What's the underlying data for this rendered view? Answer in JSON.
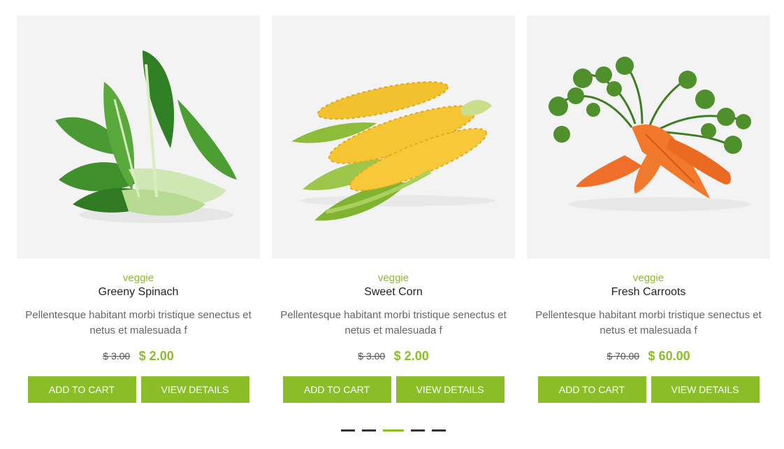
{
  "products": [
    {
      "category": "veggie",
      "name": "Greeny Spinach",
      "description": "Pellentesque habitant morbi tristique senectus et netus et malesuada f",
      "old_price": "$ 3.00",
      "price": "$ 2.00",
      "add_to_cart": "ADD TO CART",
      "view_details": "VIEW DETAILS",
      "image": "spinach-image"
    },
    {
      "category": "veggie",
      "name": "Sweet Corn",
      "description": "Pellentesque habitant morbi tristique senectus et netus et malesuada f",
      "old_price": "$ 3.00",
      "price": "$ 2.00",
      "add_to_cart": "ADD TO CART",
      "view_details": "VIEW DETAILS",
      "image": "corn-image"
    },
    {
      "category": "veggie",
      "name": "Fresh Carroots",
      "description": "Pellentesque habitant morbi tristique senectus et netus et malesuada f",
      "old_price": "$ 70.00",
      "price": "$ 60.00",
      "add_to_cart": "ADD TO CART",
      "view_details": "VIEW DETAILS",
      "image": "carrot-image"
    }
  ],
  "pagination": {
    "count": 5,
    "active_index": 2
  },
  "colors": {
    "accent": "#8bbd29",
    "image_bg": "#f3f3f3",
    "text": "#666666",
    "title": "#222222"
  }
}
